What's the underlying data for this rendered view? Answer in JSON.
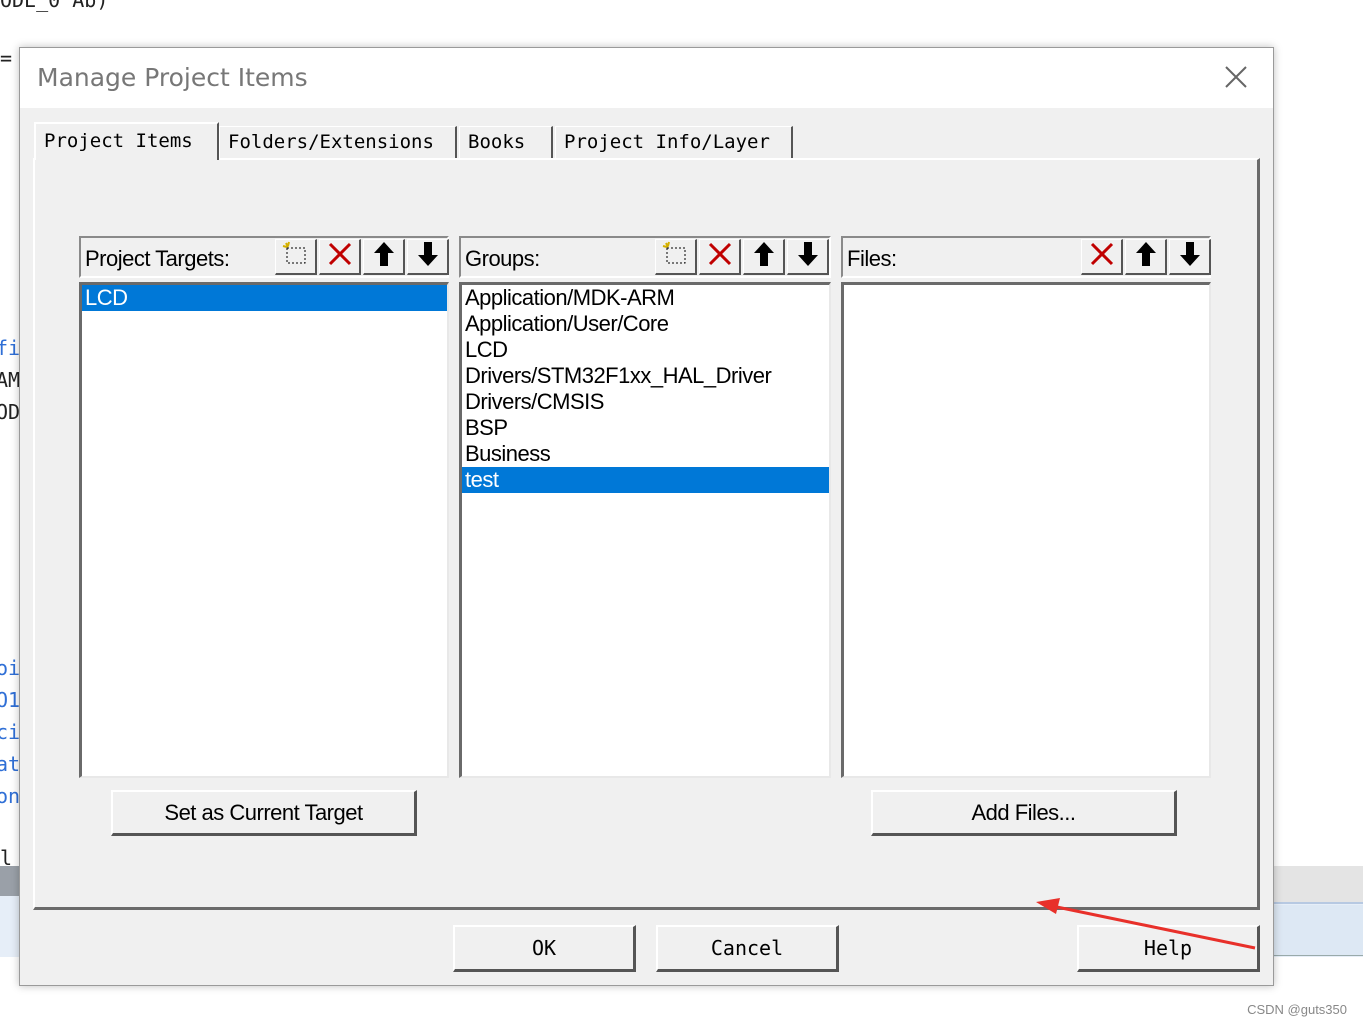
{
  "background": {
    "fragments": [
      "ODE_0 Ab)",
      "=",
      "fi",
      "AM",
      "OD",
      "oi",
      "O1",
      "ci",
      "at",
      "on",
      "l"
    ],
    "watermark": "CSDN @guts350"
  },
  "dialog": {
    "title": "Manage Project Items",
    "tabs": [
      {
        "label": "Project Items",
        "active": true
      },
      {
        "label": "Folders/Extensions",
        "active": false
      },
      {
        "label": "Books",
        "active": false
      },
      {
        "label": "Project Info/Layer",
        "active": false
      }
    ],
    "targets": {
      "header": "Project Targets:",
      "items": [
        "LCD"
      ],
      "selected_index": 0,
      "action_button": "Set as Current Target"
    },
    "groups": {
      "header": "Groups:",
      "items": [
        "Application/MDK-ARM",
        "Application/User/Core",
        "LCD",
        "Drivers/STM32F1xx_HAL_Driver",
        "Drivers/CMSIS",
        "BSP",
        "Business",
        "test"
      ],
      "selected_index": 7
    },
    "files": {
      "header": "Files:",
      "items": [],
      "action_button": "Add Files..."
    },
    "footer": {
      "ok": "OK",
      "cancel": "Cancel",
      "help": "Help"
    }
  },
  "colors": {
    "selection": "#0078d7",
    "delete_icon": "#c00000",
    "annotation_arrow": "#e8302a"
  }
}
